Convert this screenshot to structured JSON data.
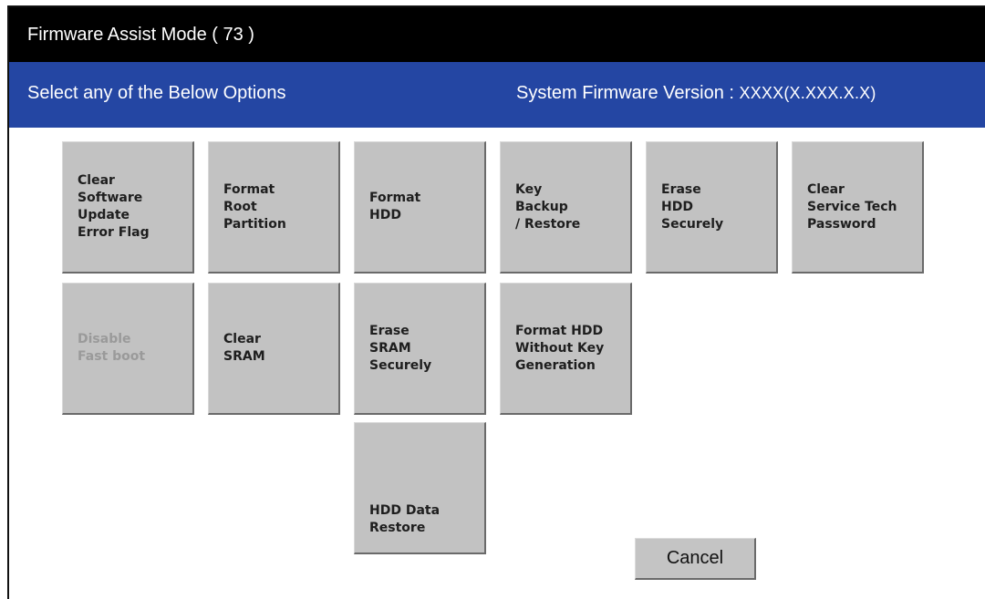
{
  "window": {
    "title": "Firmware Assist Mode ( 73 )"
  },
  "subheader": {
    "instruction": "Select any of the Below Options",
    "version_label": "System Firmware Version : ",
    "version_value": "XXXX(X.XXX.X.X)"
  },
  "options": [
    {
      "label": "Clear\nSoftware\nUpdate\nError Flag",
      "enabled": true
    },
    {
      "label": "Format\nRoot\nPartition",
      "enabled": true
    },
    {
      "label": "Format\nHDD",
      "enabled": true
    },
    {
      "label": "Key\nBackup\n/ Restore",
      "enabled": true
    },
    {
      "label": "Erase\nHDD\nSecurely",
      "enabled": true
    },
    {
      "label": "Clear\nService Tech\nPassword",
      "enabled": true
    },
    {
      "label": "Disable\nFast boot",
      "enabled": false
    },
    {
      "label": "Clear\nSRAM",
      "enabled": true
    },
    {
      "label": "Erase\nSRAM\nSecurely",
      "enabled": true
    },
    {
      "label": "Format HDD\nWithout Key\nGeneration",
      "enabled": true
    },
    {
      "label": "HDD Data\nRestore",
      "enabled": true
    }
  ],
  "cancel_label": "Cancel",
  "colors": {
    "titlebar_bg": "#000000",
    "subbar_bg": "#2446a3",
    "button_bg": "#c2c2c2",
    "disabled_text": "#9a9a9a"
  }
}
